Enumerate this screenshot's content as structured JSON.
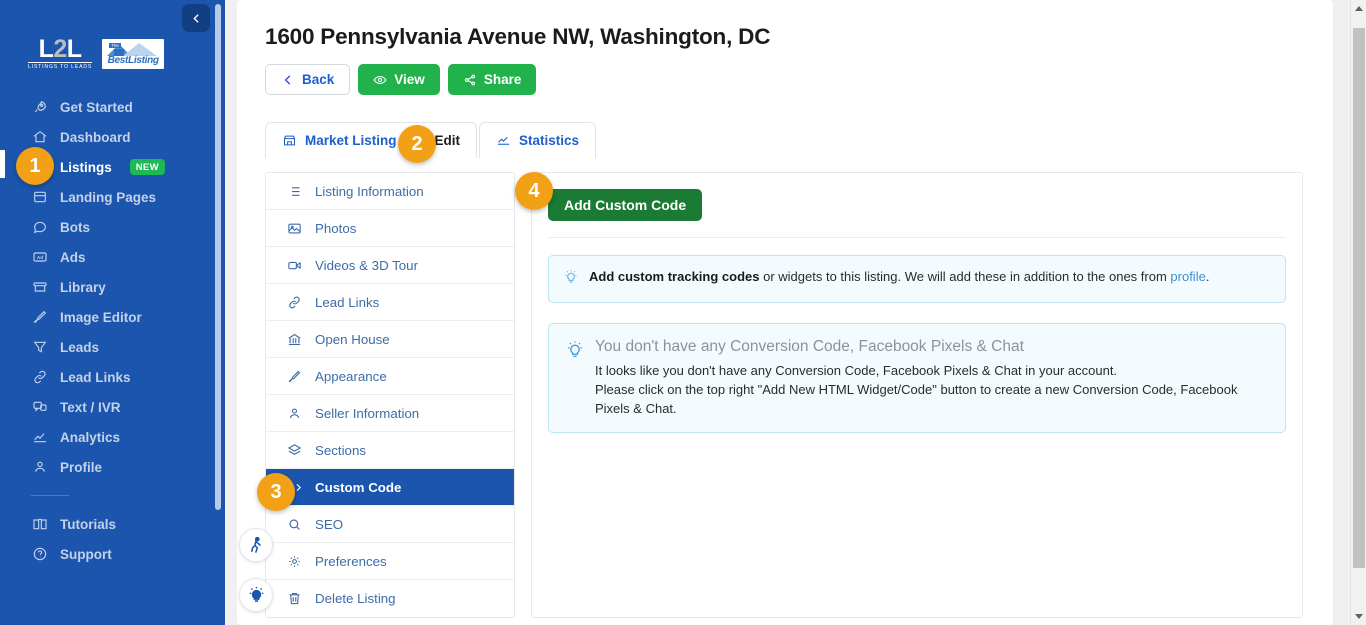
{
  "sidebar": {
    "logo": {
      "mark_left": "L",
      "mark_mid": "2",
      "mark_right": "L",
      "tagline": "LISTINGS TO LEADS",
      "partner_the": "The",
      "partner_name": "BestListing"
    },
    "collapse_icon": "chevron-left-icon",
    "items": [
      {
        "label": "Get Started",
        "icon": "rocket-icon",
        "active": false,
        "badge": ""
      },
      {
        "label": "Dashboard",
        "icon": "home-icon",
        "active": false,
        "badge": ""
      },
      {
        "label": "Listings",
        "icon": "grid-icon",
        "active": true,
        "badge": "NEW"
      },
      {
        "label": "Landing Pages",
        "icon": "window-icon",
        "active": false,
        "badge": ""
      },
      {
        "label": "Bots",
        "icon": "chat-bubble-icon",
        "active": false,
        "badge": ""
      },
      {
        "label": "Ads",
        "icon": "ad-icon",
        "active": false,
        "badge": ""
      },
      {
        "label": "Library",
        "icon": "archive-icon",
        "active": false,
        "badge": ""
      },
      {
        "label": "Image Editor",
        "icon": "brush-icon",
        "active": false,
        "badge": ""
      },
      {
        "label": "Leads",
        "icon": "funnel-icon",
        "active": false,
        "badge": ""
      },
      {
        "label": "Lead Links",
        "icon": "link-icon",
        "active": false,
        "badge": ""
      },
      {
        "label": "Text / IVR",
        "icon": "sms-icon",
        "active": false,
        "badge": ""
      },
      {
        "label": "Analytics",
        "icon": "chart-icon",
        "active": false,
        "badge": ""
      },
      {
        "label": "Profile",
        "icon": "user-icon",
        "active": false,
        "badge": ""
      }
    ],
    "footer_items": [
      {
        "label": "Tutorials",
        "icon": "book-icon"
      },
      {
        "label": "Support",
        "icon": "question-circle-icon"
      }
    ]
  },
  "header": {
    "title": "1600 Pennsylvania Avenue NW, Washington, DC",
    "buttons": [
      {
        "label": "Back",
        "icon": "chevron-left-icon",
        "style": "outline"
      },
      {
        "label": "View",
        "icon": "eye-icon",
        "style": "green"
      },
      {
        "label": "Share",
        "icon": "share-icon",
        "style": "green"
      }
    ]
  },
  "tabs": [
    {
      "label": "Market Listing",
      "icon": "store-icon",
      "suffix": "Edit",
      "active": true
    },
    {
      "label": "Statistics",
      "icon": "chart-icon",
      "suffix": "",
      "active": false
    }
  ],
  "side_menu": [
    {
      "label": "Listing Information",
      "icon": "list-icon",
      "active": false
    },
    {
      "label": "Photos",
      "icon": "photo-icon",
      "active": false
    },
    {
      "label": "Videos & 3D Tour",
      "icon": "video-icon",
      "active": false
    },
    {
      "label": "Lead Links",
      "icon": "link-icon",
      "active": false
    },
    {
      "label": "Open House",
      "icon": "bank-icon",
      "active": false
    },
    {
      "label": "Appearance",
      "icon": "brush-icon",
      "active": false
    },
    {
      "label": "Seller Information",
      "icon": "user-icon",
      "active": false
    },
    {
      "label": "Sections",
      "icon": "layers-icon",
      "active": false
    },
    {
      "label": "Custom Code",
      "icon": "code-icon",
      "active": true
    },
    {
      "label": "SEO",
      "icon": "search-icon",
      "active": false
    },
    {
      "label": "Preferences",
      "icon": "gear-icon",
      "active": false
    },
    {
      "label": "Delete Listing",
      "icon": "trash-icon",
      "active": false
    }
  ],
  "content": {
    "add_button_label": "Add Custom Code",
    "info_alert": {
      "icon": "lightbulb-icon",
      "strong": "Add custom tracking codes",
      "rest": " or widgets to this listing. We will add these in addition to the ones from ",
      "link": "profile",
      "end": "."
    },
    "empty_alert": {
      "icon": "lightbulb-icon",
      "title": "You don't have any Conversion Code, Facebook Pixels & Chat",
      "line1": "It looks like you don't have any Conversion Code, Facebook Pixels & Chat in your account.",
      "line2": "Please click on the top right \"Add New HTML Widget/Code\" button to create a new Conversion Code, Facebook Pixels & Chat."
    }
  },
  "fabs": [
    {
      "name": "walkthrough-icon"
    },
    {
      "name": "tips-bulb-icon"
    }
  ],
  "steps": [
    {
      "number": "1"
    },
    {
      "number": "2"
    },
    {
      "number": "3"
    },
    {
      "number": "4"
    }
  ],
  "colors": {
    "sidebar_blue": "#1b55ae",
    "accent_green": "#22b24c",
    "dark_green": "#1b7a33",
    "step_orange": "#f2a116",
    "new_badge_green": "#1db954",
    "link_blue": "#1d5fcc",
    "alert_border": "#bfe2f5",
    "alert_bg": "#f4fbfe"
  }
}
